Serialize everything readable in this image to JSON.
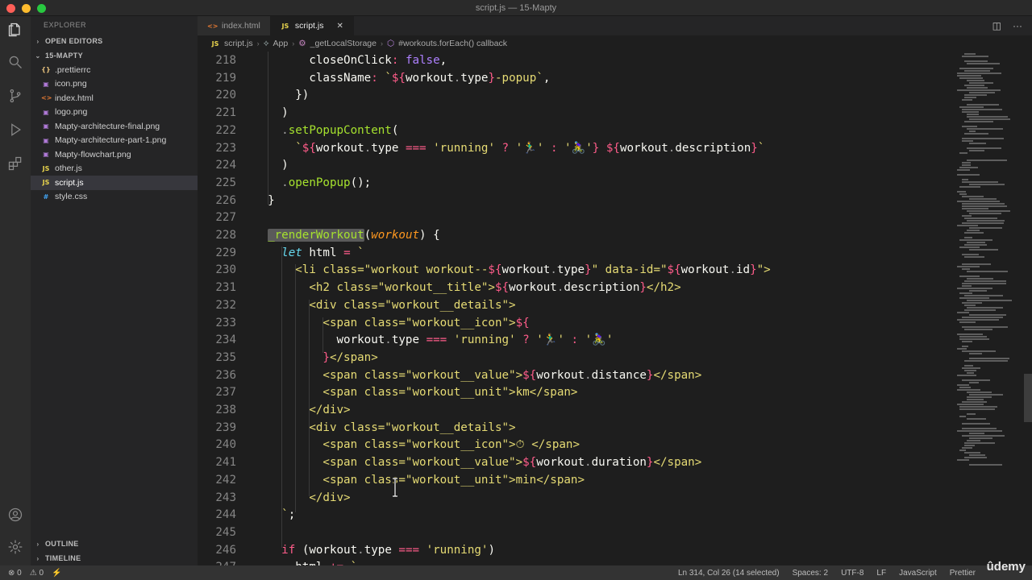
{
  "window": {
    "title": "script.js — 15-Mapty"
  },
  "sidebar": {
    "header": "EXPLORER",
    "open_editors": "OPEN EDITORS",
    "project": "15-MAPTY",
    "files": [
      {
        "name": ".prettierrc",
        "icon": "{}",
        "color": "#e5c07b"
      },
      {
        "name": "icon.png",
        "icon": "▣",
        "color": "#b07ad8"
      },
      {
        "name": "index.html",
        "icon": "<>",
        "color": "#e37933"
      },
      {
        "name": "logo.png",
        "icon": "▣",
        "color": "#b07ad8"
      },
      {
        "name": "Mapty-architecture-final.png",
        "icon": "▣",
        "color": "#b07ad8"
      },
      {
        "name": "Mapty-architecture-part-1.png",
        "icon": "▣",
        "color": "#b07ad8"
      },
      {
        "name": "Mapty-flowchart.png",
        "icon": "▣",
        "color": "#b07ad8"
      },
      {
        "name": "other.js",
        "icon": "JS",
        "color": "#e8d44d"
      },
      {
        "name": "script.js",
        "icon": "JS",
        "color": "#e8d44d"
      },
      {
        "name": "style.css",
        "icon": "#",
        "color": "#42a5f5"
      }
    ],
    "outline": "OUTLINE",
    "timeline": "TIMELINE"
  },
  "tabs": [
    {
      "label": "index.html",
      "icon": "<>"
    },
    {
      "label": "script.js",
      "icon": "JS",
      "close": "✕"
    }
  ],
  "breadcrumb": [
    "script.js",
    "App",
    "_getLocalStorage",
    "#workouts.forEach() callback"
  ],
  "code": {
    "lines": [
      {
        "n": "218",
        "html": "        <span class=\"p\">closeOnClick</span><span class=\"k\">:</span> <span class=\"b\">false</span><span class=\"p\">,</span>"
      },
      {
        "n": "219",
        "html": "        <span class=\"p\">className</span><span class=\"k\">:</span> <span class=\"s\">`</span><span class=\"k\">${</span><span class=\"p\">workout</span><span class=\"dim\">.</span><span class=\"p\">type</span><span class=\"k\">}</span><span class=\"s\">-popup`</span><span class=\"p\">,</span>"
      },
      {
        "n": "220",
        "html": "      <span class=\"p\">})</span>"
      },
      {
        "n": "221",
        "html": "    <span class=\"p\">)</span>"
      },
      {
        "n": "222",
        "html": "    <span class=\"dim\">.</span><span class=\"f\">setPopupContent</span><span class=\"p\">(</span>"
      },
      {
        "n": "223",
        "html": "      <span class=\"s\">`</span><span class=\"k\">${</span><span class=\"p\">workout</span><span class=\"dim\">.</span><span class=\"p\">type</span> <span class=\"k\">===</span> <span class=\"s\">'running'</span> <span class=\"k\">?</span> <span class=\"s\">'🏃‍♂️'</span> <span class=\"k\">:</span> <span class=\"s\">'🚴‍♀️'</span><span class=\"k\">}</span> <span class=\"k\">${</span><span class=\"p\">workout</span><span class=\"dim\">.</span><span class=\"p\">description</span><span class=\"k\">}</span><span class=\"s\">`</span>"
      },
      {
        "n": "224",
        "html": "    <span class=\"p\">)</span>"
      },
      {
        "n": "225",
        "html": "    <span class=\"dim\">.</span><span class=\"f\">openPopup</span><span class=\"p\">();</span>"
      },
      {
        "n": "226",
        "html": "  <span class=\"p\">}</span>"
      },
      {
        "n": "227",
        "html": ""
      },
      {
        "n": "228",
        "html": "  <span class=\"f hl\">_renderWorkout</span><span class=\"p\">(</span><span class=\"v\">workout</span><span class=\"p\">) {</span>"
      },
      {
        "n": "229",
        "html": "    <span class=\"it\">let</span> <span class=\"p\">html</span> <span class=\"k\">=</span> <span class=\"s\">`</span>"
      },
      {
        "n": "230",
        "html": "      <span class=\"s\">&lt;li class=\"workout workout--</span><span class=\"k\">${</span><span class=\"p\">workout</span><span class=\"dim\">.</span><span class=\"p\">type</span><span class=\"k\">}</span><span class=\"s\">\" data-id=\"</span><span class=\"k\">${</span><span class=\"p\">workout</span><span class=\"dim\">.</span><span class=\"p\">id</span><span class=\"k\">}</span><span class=\"s\">\"&gt;</span>"
      },
      {
        "n": "231",
        "html": "        <span class=\"s\">&lt;h2 class=\"workout__title\"&gt;</span><span class=\"k\">${</span><span class=\"p\">workout</span><span class=\"dim\">.</span><span class=\"p\">description</span><span class=\"k\">}</span><span class=\"s\">&lt;/h2&gt;</span>"
      },
      {
        "n": "232",
        "html": "        <span class=\"s\">&lt;div class=\"workout__details\"&gt;</span>"
      },
      {
        "n": "233",
        "html": "          <span class=\"s\">&lt;span class=\"workout__icon\"&gt;</span><span class=\"k\">${</span>"
      },
      {
        "n": "234",
        "html": "            <span class=\"p\">workout</span><span class=\"dim\">.</span><span class=\"p\">type</span> <span class=\"k\">===</span> <span class=\"s\">'running'</span> <span class=\"k\">?</span> <span class=\"s\">'🏃‍♂️'</span> <span class=\"k\">:</span> <span class=\"s\">'🚴‍♀️'</span>"
      },
      {
        "n": "235",
        "html": "          <span class=\"k\">}</span><span class=\"s\">&lt;/span&gt;</span>"
      },
      {
        "n": "236",
        "html": "          <span class=\"s\">&lt;span class=\"workout__value\"&gt;</span><span class=\"k\">${</span><span class=\"p\">workout</span><span class=\"dim\">.</span><span class=\"p\">distance</span><span class=\"k\">}</span><span class=\"s\">&lt;/span&gt;</span>"
      },
      {
        "n": "237",
        "html": "          <span class=\"s\">&lt;span class=\"workout__unit\"&gt;km&lt;/span&gt;</span>"
      },
      {
        "n": "238",
        "html": "        <span class=\"s\">&lt;/div&gt;</span>"
      },
      {
        "n": "239",
        "html": "        <span class=\"s\">&lt;div class=\"workout__details\"&gt;</span>"
      },
      {
        "n": "240",
        "html": "          <span class=\"s\">&lt;span class=\"workout__icon\"&gt;⏱ &lt;/span&gt;</span>"
      },
      {
        "n": "241",
        "html": "          <span class=\"s\">&lt;span class=\"workout__value\"&gt;</span><span class=\"k\">${</span><span class=\"p\">workout</span><span class=\"dim\">.</span><span class=\"p\">duration</span><span class=\"k\">}</span><span class=\"s\">&lt;/span&gt;</span>"
      },
      {
        "n": "242",
        "html": "          <span class=\"s\">&lt;span class=\"workout__unit\"&gt;min&lt;/span&gt;</span>"
      },
      {
        "n": "243",
        "html": "        <span class=\"s\">&lt;/div&gt;</span>"
      },
      {
        "n": "244",
        "html": "    <span class=\"s\">`</span><span class=\"p\">;</span>"
      },
      {
        "n": "245",
        "html": ""
      },
      {
        "n": "246",
        "html": "    <span class=\"k\">if</span> <span class=\"p\">(workout</span><span class=\"dim\">.</span><span class=\"p\">type</span> <span class=\"k\">===</span> <span class=\"s\">'running'</span><span class=\"p\">)</span>"
      },
      {
        "n": "247",
        "html": "      <span class=\"p\">html</span> <span class=\"k\">+=</span> <span class=\"s\">`</span>"
      }
    ]
  },
  "statusbar": {
    "errors": "⊗ 0",
    "warnings": "⚠ 0",
    "position": "Ln 314, Col 26 (14 selected)",
    "spaces": "Spaces: 2",
    "encoding": "UTF-8",
    "eol": "LF",
    "language": "JavaScript",
    "formatter": "Prettier"
  },
  "watermark": "ûdemy"
}
